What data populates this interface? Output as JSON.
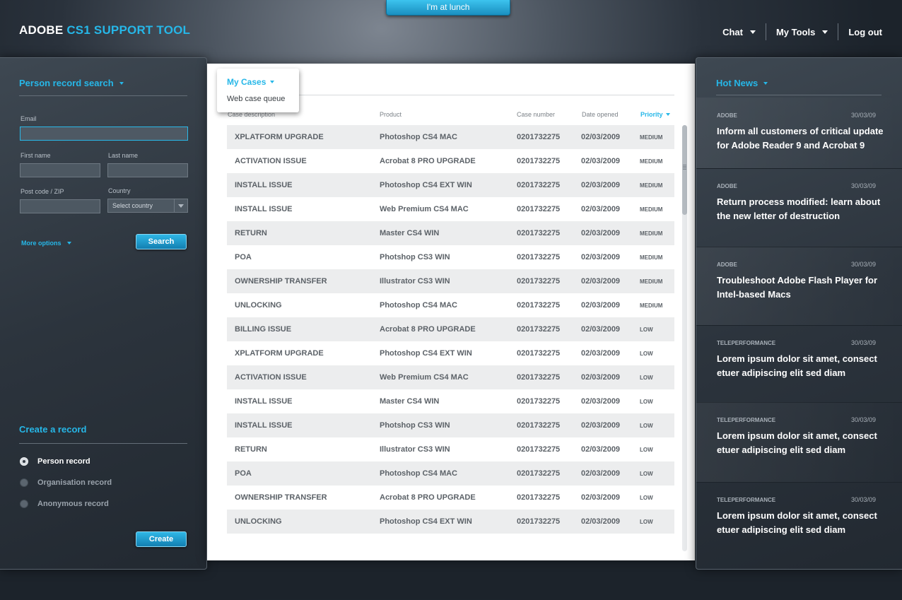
{
  "app": {
    "logo_main": "ADOBE ",
    "logo_accent": "CS1 SUPPORT TOOL",
    "lunch_button": "I'm at lunch"
  },
  "nav": {
    "chat": "Chat",
    "tools": "My Tools",
    "logout": "Log out"
  },
  "search": {
    "title": "Person record search",
    "email_label": "Email",
    "first_name_label": "First name",
    "last_name_label": "Last name",
    "postcode_label": "Post code / ZIP",
    "country_label": "Country",
    "country_value": "Select country",
    "more_options": "More options",
    "search_button": "Search"
  },
  "create": {
    "title": "Create a record",
    "options": [
      "Person record",
      "Organisation record",
      "Anonymous record"
    ],
    "selected": "Person record",
    "create_button": "Create"
  },
  "cases": {
    "title": "My Cases",
    "menu_item": "Web case queue",
    "columns": {
      "desc": "Case description",
      "product": "Product",
      "case_number": "Case number",
      "date": "Date opened",
      "priority": "Priority"
    },
    "rows": [
      [
        "XPLATFORM UPGRADE",
        "Photoshop CS4 MAC",
        "0201732275",
        "02/03/2009",
        "MEDIUM"
      ],
      [
        "ACTIVATION ISSUE",
        "Acrobat 8 PRO UPGRADE",
        "0201732275",
        "02/03/2009",
        "MEDIUM"
      ],
      [
        "INSTALL ISSUE",
        "Photoshop CS4 EXT WIN",
        "0201732275",
        "02/03/2009",
        "MEDIUM"
      ],
      [
        "INSTALL ISSUE",
        "Web Premium CS4 MAC",
        "0201732275",
        "02/03/2009",
        "MEDIUM"
      ],
      [
        "RETURN",
        "Master CS4 WIN",
        "0201732275",
        "02/03/2009",
        "MEDIUM"
      ],
      [
        "POA",
        "Photshop CS3 WIN",
        "0201732275",
        "02/03/2009",
        "MEDIUM"
      ],
      [
        "OWNERSHIP TRANSFER",
        "Illustrator CS3 WIN",
        "0201732275",
        "02/03/2009",
        "MEDIUM"
      ],
      [
        "UNLOCKING",
        "Photoshop CS4 MAC",
        "0201732275",
        "02/03/2009",
        "MEDIUM"
      ],
      [
        "BILLING ISSUE",
        "Acrobat 8 PRO UPGRADE",
        "0201732275",
        "02/03/2009",
        "LOW"
      ],
      [
        "XPLATFORM UPGRADE",
        "Photoshop CS4 EXT WIN",
        "0201732275",
        "02/03/2009",
        "LOW"
      ],
      [
        "ACTIVATION ISSUE",
        "Web Premium CS4 MAC",
        "0201732275",
        "02/03/2009",
        "LOW"
      ],
      [
        "INSTALL ISSUE",
        "Master CS4 WIN",
        "0201732275",
        "02/03/2009",
        "LOW"
      ],
      [
        "INSTALL ISSUE",
        "Photshop CS3 WIN",
        "0201732275",
        "02/03/2009",
        "LOW"
      ],
      [
        "RETURN",
        "Illustrator CS3 WIN",
        "0201732275",
        "02/03/2009",
        "LOW"
      ],
      [
        "POA",
        "Photoshop CS4 MAC",
        "0201732275",
        "02/03/2009",
        "LOW"
      ],
      [
        "OWNERSHIP TRANSFER",
        "Acrobat 8 PRO UPGRADE",
        "0201732275",
        "02/03/2009",
        "LOW"
      ],
      [
        "UNLOCKING",
        "Photoshop CS4 EXT WIN",
        "0201732275",
        "02/03/2009",
        "LOW"
      ]
    ]
  },
  "news": {
    "title": "Hot News",
    "items": [
      {
        "source": "ADOBE",
        "date": "30/03/09",
        "headline": "Inform all customers of critical update for Adobe Reader 9 and Acrobat 9"
      },
      {
        "source": "ADOBE",
        "date": "30/03/09",
        "headline": "Return process modified: learn about the new letter of destruction"
      },
      {
        "source": "ADOBE",
        "date": "30/03/09",
        "headline": "Troubleshoot Adobe Flash Player for Intel-based Macs"
      },
      {
        "source": "TELEPERFORMANCE",
        "date": "30/03/09",
        "headline": "Lorem ipsum dolor sit amet, consect etuer adipiscing elit sed diam"
      },
      {
        "source": "TELEPERFORMANCE",
        "date": "30/03/09",
        "headline": "Lorem ipsum dolor sit amet, consect etuer adipiscing elit sed diam"
      },
      {
        "source": "TELEPERFORMANCE",
        "date": "30/03/09",
        "headline": "Lorem ipsum dolor sit amet, consect etuer adipiscing elit sed diam"
      }
    ]
  },
  "colors": {
    "accent": "#26b7e8",
    "panel": "#2f3841",
    "row_alt": "#ecedee"
  }
}
